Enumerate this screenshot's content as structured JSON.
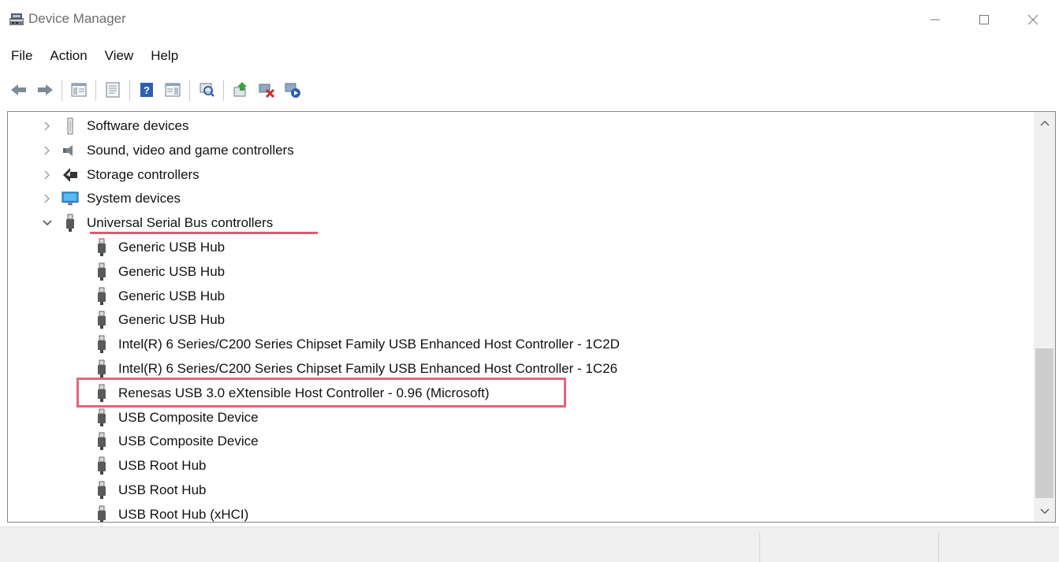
{
  "window": {
    "title": "Device Manager",
    "controls": {
      "minimize": "minimize-icon",
      "maximize": "maximize-icon",
      "close": "close-icon"
    }
  },
  "menu": [
    "File",
    "Action",
    "View",
    "Help"
  ],
  "toolbar": [
    "back-arrow-icon",
    "forward-arrow-icon",
    "separator",
    "show-hide-console-tree-icon",
    "separator",
    "properties-icon",
    "separator",
    "help-icon",
    "show-action-pane-icon",
    "separator",
    "scan-hardware-changes-icon",
    "separator",
    "update-driver-icon",
    "uninstall-device-icon",
    "enable-device-icon"
  ],
  "tree": {
    "categories": [
      {
        "label": "Software devices",
        "icon": "software-devices-icon",
        "expanded": false
      },
      {
        "label": "Sound, video and game controllers",
        "icon": "speaker-icon",
        "expanded": false
      },
      {
        "label": "Storage controllers",
        "icon": "storage-controller-icon",
        "expanded": false
      },
      {
        "label": "System devices",
        "icon": "monitor-icon",
        "expanded": false
      },
      {
        "label": "Universal Serial Bus controllers",
        "icon": "usb-plug-icon",
        "expanded": true
      }
    ],
    "usb_children": [
      "Generic USB Hub",
      "Generic USB Hub",
      "Generic USB Hub",
      "Generic USB Hub",
      "Intel(R) 6 Series/C200 Series Chipset Family USB Enhanced Host Controller - 1C2D",
      "Intel(R) 6 Series/C200 Series Chipset Family USB Enhanced Host Controller - 1C26",
      "Renesas USB 3.0 eXtensible Host Controller - 0.96 (Microsoft)",
      "USB Composite Device",
      "USB Composite Device",
      "USB Root Hub",
      "USB Root Hub",
      "USB Root Hub (xHCI)"
    ],
    "highlighted_child": "Renesas USB 3.0 eXtensible Host Controller - 0.96 (Microsoft)"
  },
  "colors": {
    "annotation_red": "#e86477",
    "title_text": "#6e6e6e",
    "panel_border": "#828790"
  }
}
